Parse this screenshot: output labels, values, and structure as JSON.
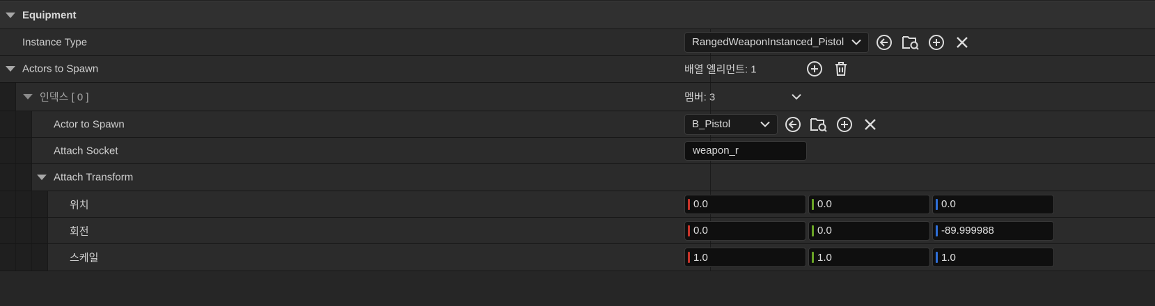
{
  "category": {
    "label": "Equipment"
  },
  "instance_type": {
    "label": "Instance Type",
    "value": "RangedWeaponInstanced_Pistol"
  },
  "actors_to_spawn": {
    "label": "Actors to Spawn",
    "array_info": "배열 엘리먼트: 1"
  },
  "index0": {
    "label": "인덱스 [ 0 ]",
    "members": "멤버: 3"
  },
  "actor_to_spawn": {
    "label": "Actor to Spawn",
    "value": "B_Pistol"
  },
  "attach_socket": {
    "label": "Attach Socket",
    "value": "weapon_r"
  },
  "attach_transform": {
    "label": "Attach Transform"
  },
  "location": {
    "label": "위치",
    "x": "0.0",
    "y": "0.0",
    "z": "0.0"
  },
  "rotation": {
    "label": "회전",
    "x": "0.0",
    "y": "0.0",
    "z": "-89.999988"
  },
  "scale": {
    "label": "스케일",
    "x": "1.0",
    "y": "1.0",
    "z": "1.0"
  },
  "colors": {
    "axis_x": "#c8342a",
    "axis_y": "#6aa526",
    "axis_z": "#2f6fd8",
    "background": "#242424",
    "row": "#2b2b2b",
    "input": "#0f0f0f"
  },
  "icons": {
    "use_selected": "arrow-left-circle-icon",
    "browse": "folder-search-icon",
    "add": "plus-circle-icon",
    "clear": "close-icon",
    "delete": "trash-icon",
    "expand": "triangle-down-icon",
    "dropdown": "chevron-down-icon"
  }
}
